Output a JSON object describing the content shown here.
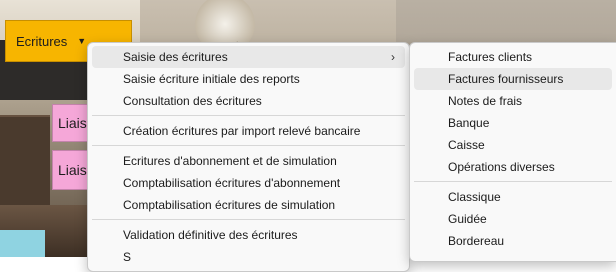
{
  "toolbar": {
    "ecritures_label": "Ecritures",
    "dropdown_glyph": "▼"
  },
  "tiles": [
    {
      "label": "Liais"
    },
    {
      "label": "Liais"
    }
  ],
  "menu": {
    "groups": [
      [
        "Saisie des écritures",
        "Saisie écriture initiale des reports",
        "Consultation des écritures"
      ],
      [
        "Création écritures par import relevé bancaire"
      ],
      [
        "Ecritures d'abonnement et de simulation",
        "Comptabilisation écritures d'abonnement",
        "Comptabilisation écritures de simulation"
      ],
      [
        "Validation définitive des écritures",
        "S"
      ]
    ],
    "submenu_glyph": "›"
  },
  "submenu": {
    "groups": [
      [
        "Factures clients",
        "Factures fournisseurs",
        "Notes de frais",
        "Banque",
        "Caisse",
        "Opérations diverses"
      ],
      [
        "Classique",
        "Guidée",
        "Bordereau"
      ]
    ]
  },
  "colors": {
    "accent": "#f7b500",
    "tile": "#f5a7d8",
    "hover": "#e8e8e8"
  }
}
